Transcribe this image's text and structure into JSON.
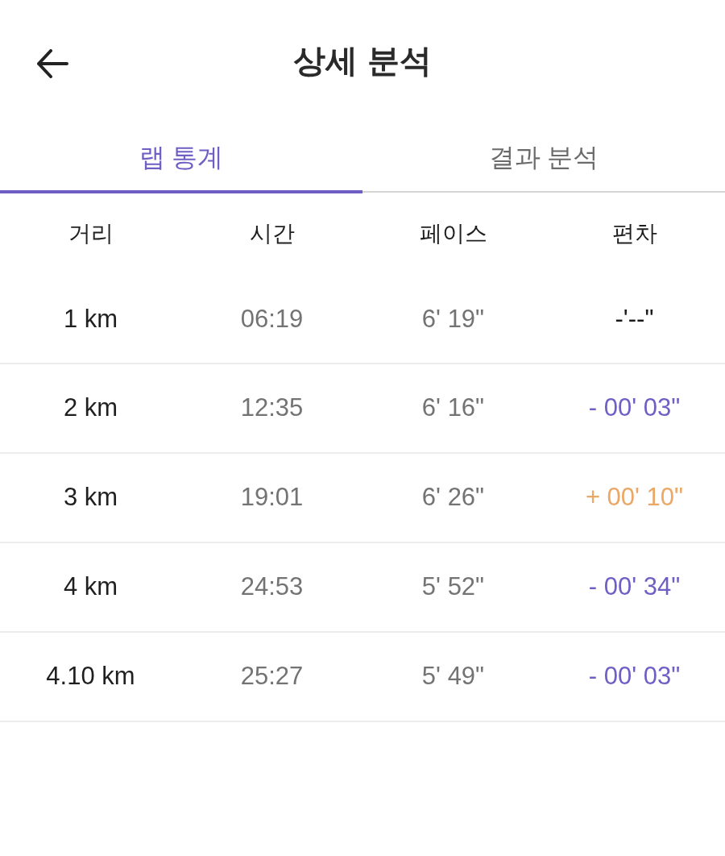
{
  "header": {
    "title": "상세 분석"
  },
  "tabs": [
    {
      "label": "랩 통계",
      "selected": true
    },
    {
      "label": "결과 분석",
      "selected": false
    }
  ],
  "table": {
    "columns": [
      "거리",
      "시간",
      "페이스",
      "편차"
    ],
    "rows": [
      {
        "distance": "1 km",
        "time": "06:19",
        "pace": "6' 19\"",
        "deviation": {
          "text": "-'--\"",
          "color": "#1a1a1a"
        }
      },
      {
        "distance": "2 km",
        "time": "12:35",
        "pace": "6' 16\"",
        "deviation": {
          "text": "- 00' 03\"",
          "color": "#6f5fc4"
        }
      },
      {
        "distance": "3 km",
        "time": "19:01",
        "pace": "6' 26\"",
        "deviation": {
          "text": "+ 00' 10\"",
          "color": "#eba765"
        }
      },
      {
        "distance": "4 km",
        "time": "24:53",
        "pace": "5' 52\"",
        "deviation": {
          "text": "- 00' 34\"",
          "color": "#6f5fc4"
        }
      },
      {
        "distance": "4.10 km",
        "time": "25:27",
        "pace": "5' 49\"",
        "deviation": {
          "text": "- 00' 03\"",
          "color": "#6f5fc4"
        }
      }
    ]
  }
}
